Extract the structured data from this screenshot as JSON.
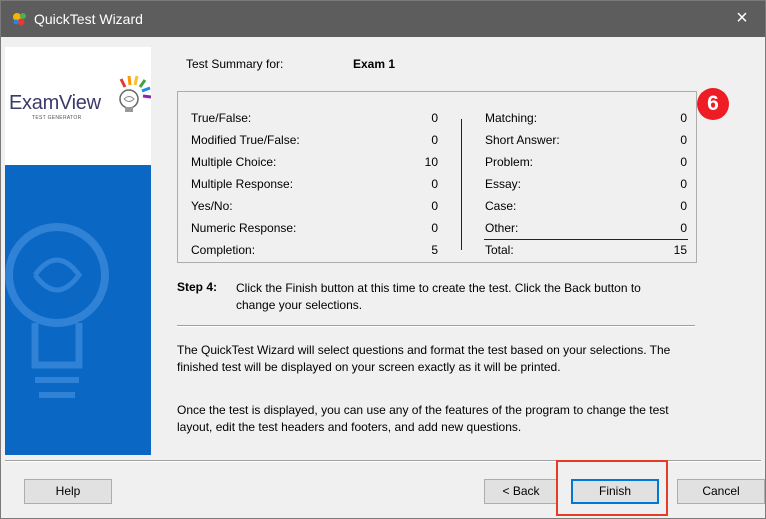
{
  "window": {
    "title": "QuickTest Wizard",
    "close_icon": "×"
  },
  "logo": {
    "brand": "ExamView",
    "registered": "®",
    "subtitle": "TEST GENERATOR"
  },
  "summary": {
    "label": "Test Summary for:",
    "test_name": "Exam 1"
  },
  "counts": {
    "left": [
      {
        "label": "True/False:",
        "value": "0"
      },
      {
        "label": "Modified True/False:",
        "value": "0"
      },
      {
        "label": "Multiple Choice:",
        "value": "10"
      },
      {
        "label": "Multiple Response:",
        "value": "0"
      },
      {
        "label": "Yes/No:",
        "value": "0"
      },
      {
        "label": "Numeric Response:",
        "value": "0"
      },
      {
        "label": "Completion:",
        "value": "5"
      }
    ],
    "right": [
      {
        "label": "Matching:",
        "value": "0"
      },
      {
        "label": "Short Answer:",
        "value": "0"
      },
      {
        "label": "Problem:",
        "value": "0"
      },
      {
        "label": "Essay:",
        "value": "0"
      },
      {
        "label": "Case:",
        "value": "0"
      },
      {
        "label": "Other:",
        "value": "0"
      },
      {
        "label": "Total:",
        "value": "15"
      }
    ]
  },
  "annotation": {
    "badge": "6",
    "badge_color": "#ee1c25",
    "highlight_color": "#e53c28"
  },
  "step": {
    "label": "Step 4:",
    "text": "Click the Finish button at this time to create the test. Click the Back button to change your selections."
  },
  "paragraphs": [
    "The QuickTest Wizard will select questions and format the test based on your selections. The finished test will be displayed on your screen exactly as it will be printed.",
    "Once the test is displayed, you can use any of the features of the program to change the test layout, edit the test headers and footers, and add new questions."
  ],
  "buttons": {
    "help": "Help",
    "back": "< Back",
    "finish": "Finish",
    "cancel": "Cancel"
  },
  "colors": {
    "sidebar_blue": "#0a68c4",
    "titlebar": "#5d5d5d"
  }
}
